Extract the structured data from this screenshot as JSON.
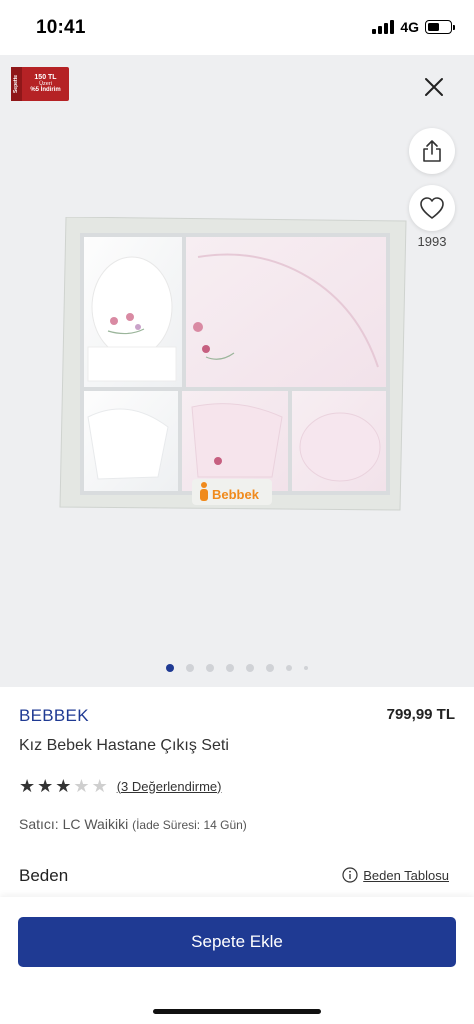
{
  "status_bar": {
    "time": "10:41",
    "network": "4G",
    "signal_bars": 4,
    "battery_level": 0.5
  },
  "gallery": {
    "promo_badge": {
      "side_text": "Sepette",
      "line1": "150 TL",
      "line2": "Üzeri",
      "line3": "%5 İndirim"
    },
    "favorite_count": "1993",
    "product_photo_brand": "Bebbek",
    "page_indicator": {
      "total": 8,
      "active_index": 0
    },
    "icons": {
      "close": "close-icon",
      "share": "share-icon",
      "favorite": "heart-icon"
    }
  },
  "product": {
    "brand": "BEBBEK",
    "price": "799,99 TL",
    "name": "Kız Bebek Hastane Çıkış Seti",
    "rating": 3,
    "rating_max": 5,
    "reviews_link": "(3 Değerlendirme)",
    "seller_label": "Satıcı:",
    "seller_name": "LC Waikiki",
    "return_time": "(İade Süresi: 14 Gün)",
    "size_label": "Beden",
    "size_table_link": "Beden Tablosu"
  },
  "actions": {
    "add_to_cart": "Sepete Ekle"
  },
  "colors": {
    "accent": "#1f3a93",
    "promo": "#b52225",
    "image_bg": "#eeeff1"
  }
}
